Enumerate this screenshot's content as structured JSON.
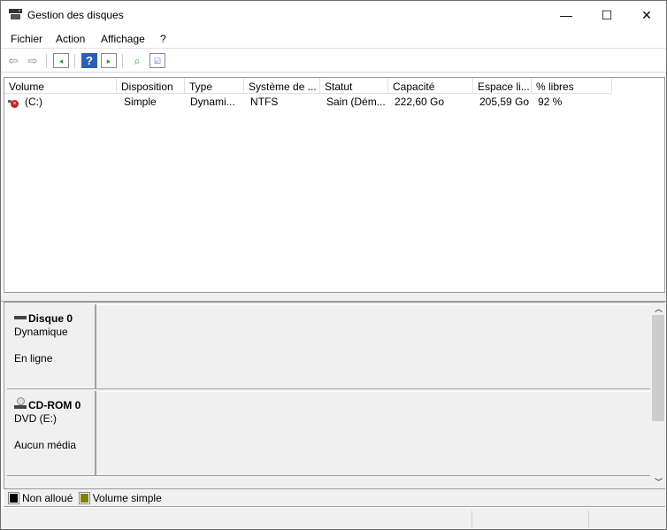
{
  "window": {
    "title": "Gestion des disques",
    "minimize": "—",
    "maximize": "☐",
    "close": "✕"
  },
  "menu": [
    "Fichier",
    "Action",
    "Affichage",
    "?"
  ],
  "columns": [
    "Volume",
    "Disposition",
    "Type",
    "Système de ...",
    "Statut",
    "Capacité",
    "Espace li...",
    "% libres"
  ],
  "rows": [
    {
      "volume": "(C:)",
      "disposition": "Simple",
      "type": "Dynami...",
      "fs": "NTFS",
      "status": "Sain (Dém...",
      "capacity": "222,60 Go",
      "free": "205,59 Go",
      "pct": "92 %"
    }
  ],
  "disks": [
    {
      "name": "Disque 0",
      "type": "Dynamique",
      "state": "En ligne"
    },
    {
      "name": "CD-ROM 0",
      "type": "DVD (E:)",
      "state": "Aucun média"
    }
  ],
  "legend": [
    {
      "label": "Non alloué",
      "color": "#000000"
    },
    {
      "label": "Volume simple",
      "color": "#808000"
    }
  ]
}
